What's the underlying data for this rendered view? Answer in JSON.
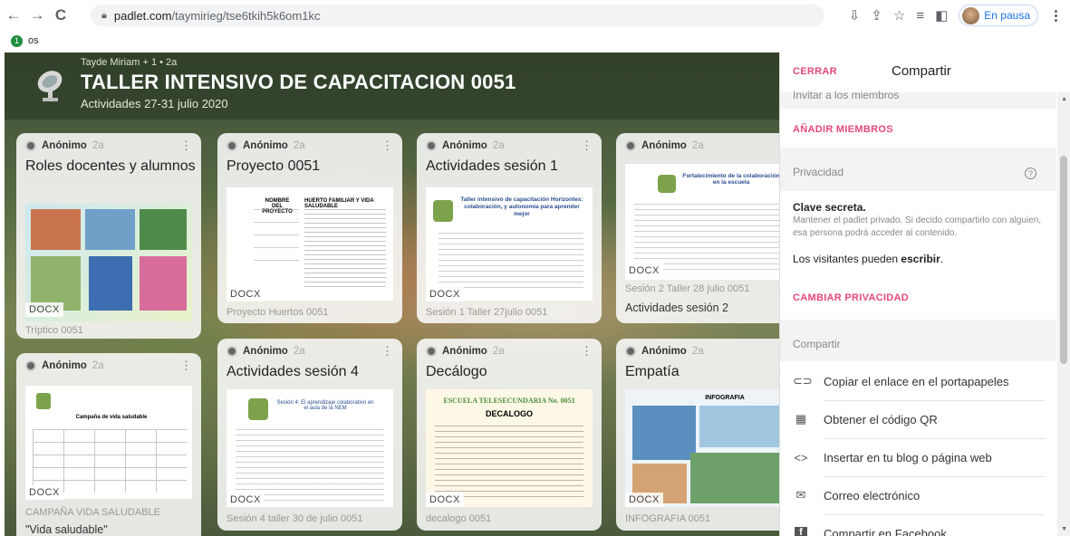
{
  "browser": {
    "url_host": "padlet.com",
    "url_path": "/taymirieg/tse6tkih5k6om1kc",
    "pause_label": "En pausa",
    "bookmark_label": "os"
  },
  "board": {
    "author": "Tayde Miriam + 1 • 2a",
    "title": "TALLER INTENSIVO DE CAPACITACION 0051",
    "subtitle": "Actividades 27-31 julio 2020"
  },
  "cards": [
    {
      "author": "Anónimo",
      "time": "2a",
      "title": "Roles docentes y alumnos",
      "docx": "DOCX",
      "caption": "Tríptico 0051",
      "caption2": ""
    },
    {
      "author": "Anónimo",
      "time": "2a",
      "title": "Proyecto 0051",
      "docx": "DOCX",
      "caption": "Proyecto Huertos 0051",
      "caption2": ""
    },
    {
      "author": "Anónimo",
      "time": "2a",
      "title": "Actividades sesión 1",
      "docx": "DOCX",
      "caption": "Sesión 1 Taller 27julio 0051",
      "caption2": ""
    },
    {
      "author": "Anónimo",
      "time": "2a",
      "title": "",
      "docx": "DOCX",
      "caption": "Sesión 2 Taller 28 julio 0051",
      "caption2": "Actividades sesión 2"
    },
    {
      "author": "Anónimo",
      "time": "2a",
      "title": "",
      "docx": "DOCX",
      "caption": "CAMPAÑA VIDA SALUDABLE",
      "caption2": "\"Vida saludable\""
    },
    {
      "author": "Anónimo",
      "time": "2a",
      "title": "Actividades sesión 4",
      "docx": "DOCX",
      "caption": "Sesión 4 taller 30 de julio 0051",
      "caption2": ""
    },
    {
      "author": "Anónimo",
      "time": "2a",
      "title": "Decálogo",
      "docx": "DOCX",
      "caption": "decalogo 0051",
      "caption2": ""
    },
    {
      "author": "Anónimo",
      "time": "2a",
      "title": "Empatía",
      "docx": "DOCX",
      "caption": "INFOGRAFIA 0051",
      "caption2": ""
    }
  ],
  "doc_snippets": {
    "proyecto_h1": "NOMBRE DEL PROYECTO",
    "proyecto_h2": "HUERTO FAMILIAR Y VIDA SALUDABLE",
    "sesion1_h": "Taller intensivo de capacitación Horizontes: colaboración, y autonomía para aprender mejor",
    "sesion2_h": "Fortalecimiento de la colaboración en la escuela",
    "salud_h": "Campaña de vida saludable",
    "sesion4_h": "Sesión 4: El aprendizaje colaborativo en el aula de la NEM",
    "decalogo_school": "ESCUELA TELESECUNDARIA No. 0051",
    "decalogo_h": "DECALOGO",
    "infografia_h": "INFOGRAFIA"
  },
  "panel": {
    "close_label": "CERRAR",
    "title": "Compartir",
    "invite_label": "Invitar a los miembros",
    "add_members": "AÑADIR MIEMBROS",
    "privacy_label": "Privacidad",
    "privacy_title": "Clave secreta.",
    "privacy_desc": "Mantener el padlet privado. Si decido compartirlo con alguien, esa persona podrá acceder al contenido.",
    "visitors_prefix": "Los visitantes pueden ",
    "visitors_action": "escribir",
    "visitors_suffix": ".",
    "change_privacy": "CAMBIAR PRIVACIDAD",
    "share_label": "Compartir",
    "share_items": [
      {
        "icon": "link-icon",
        "label": "Copiar el enlace en el portapapeles"
      },
      {
        "icon": "qr-code-icon",
        "label": "Obtener el código QR"
      },
      {
        "icon": "embed-code-icon",
        "label": "Insertar en tu blog o página web"
      },
      {
        "icon": "mail-icon",
        "label": "Correo electrónico"
      },
      {
        "icon": "facebook-icon",
        "label": "Compartir en Facebook"
      }
    ]
  },
  "colors": {
    "accent_pink": "#e5487d",
    "chrome_blue": "#1a73e8"
  }
}
